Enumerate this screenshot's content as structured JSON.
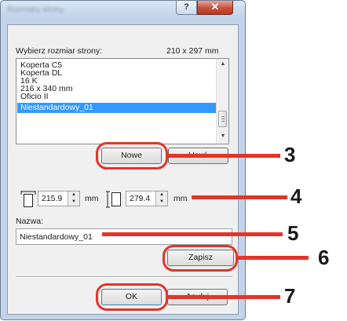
{
  "dialog": {
    "title": "Rozmiary strony",
    "help_label": "?",
    "close_label": "✕"
  },
  "page_size": {
    "label": "Wybierz rozmiar strony:",
    "current_size": "210 x 297 mm"
  },
  "size_list": {
    "items": [
      "Koperta C5",
      "Koperta DL",
      "16 K",
      "216 x 340 mm",
      "Oficio II",
      "Niestandardowy_01"
    ],
    "selected_index": 5
  },
  "buttons": {
    "new": "Nowe",
    "delete": "Usuń",
    "save": "Zapisz",
    "ok": "OK",
    "cancel": "Anuluj"
  },
  "dimensions": {
    "width_value": "215.9",
    "width_unit": "mm",
    "height_value": "279.4",
    "height_unit": "mm"
  },
  "name_field": {
    "label": "Nazwa:",
    "value": "Niestandardowy_01"
  },
  "callouts": {
    "c3": "3",
    "c4": "4",
    "c5": "5",
    "c6": "6",
    "c7": "7"
  },
  "colors": {
    "callout": "#e3342a",
    "selection": "#3399ff"
  }
}
